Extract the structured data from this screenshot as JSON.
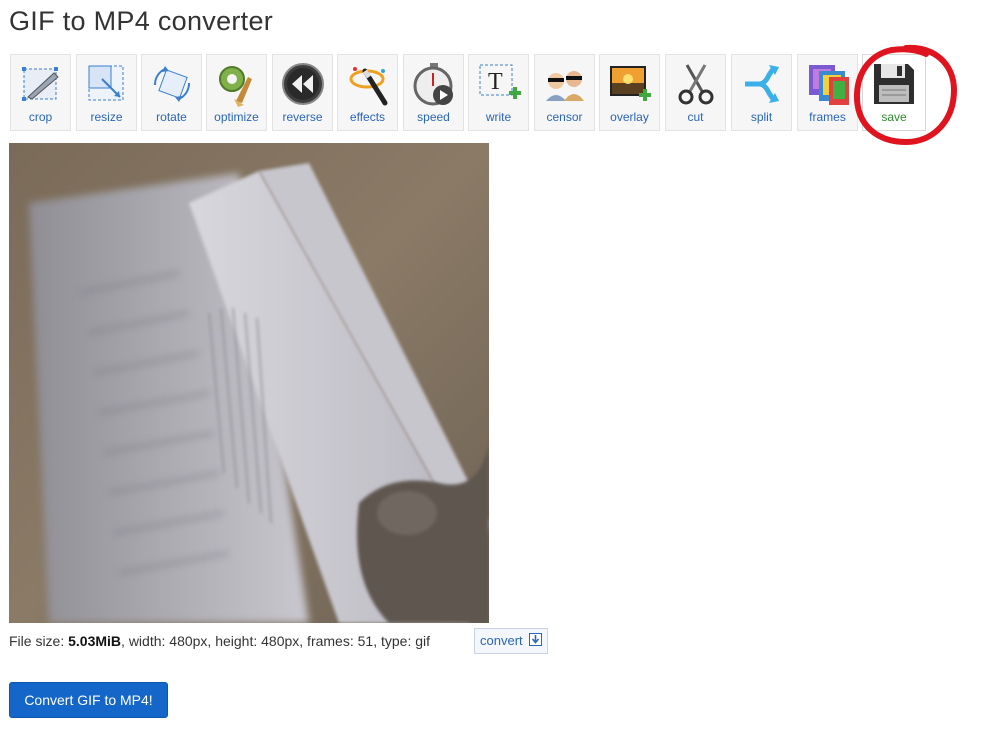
{
  "page": {
    "title": "GIF to MP4 converter"
  },
  "toolbar": {
    "items": [
      {
        "label": "crop",
        "icon": "crop-icon"
      },
      {
        "label": "resize",
        "icon": "resize-icon"
      },
      {
        "label": "rotate",
        "icon": "rotate-icon"
      },
      {
        "label": "optimize",
        "icon": "optimize-icon"
      },
      {
        "label": "reverse",
        "icon": "reverse-icon"
      },
      {
        "label": "effects",
        "icon": "effects-wand-icon"
      },
      {
        "label": "speed",
        "icon": "speed-stopwatch-icon"
      },
      {
        "label": "write",
        "icon": "write-text-icon"
      },
      {
        "label": "censor",
        "icon": "censor-icon"
      },
      {
        "label": "overlay",
        "icon": "overlay-image-icon"
      },
      {
        "label": "cut",
        "icon": "scissors-icon"
      },
      {
        "label": "split",
        "icon": "split-arrows-icon"
      },
      {
        "label": "frames",
        "icon": "frames-icon"
      },
      {
        "label": "save",
        "icon": "floppy-disk-icon",
        "active": true
      }
    ]
  },
  "file_info": {
    "size_prefix": "File size: ",
    "size_value": "5.03MiB",
    "details": ", width: 480px, height: 480px, frames: 51, type: gif",
    "convert_link": "convert"
  },
  "main_button": {
    "label": "Convert GIF to MP4!"
  },
  "colors": {
    "accent": "#1566c9",
    "link": "#2a66b8",
    "annotation": "#e0141e",
    "active_label": "#2f8a2f"
  }
}
